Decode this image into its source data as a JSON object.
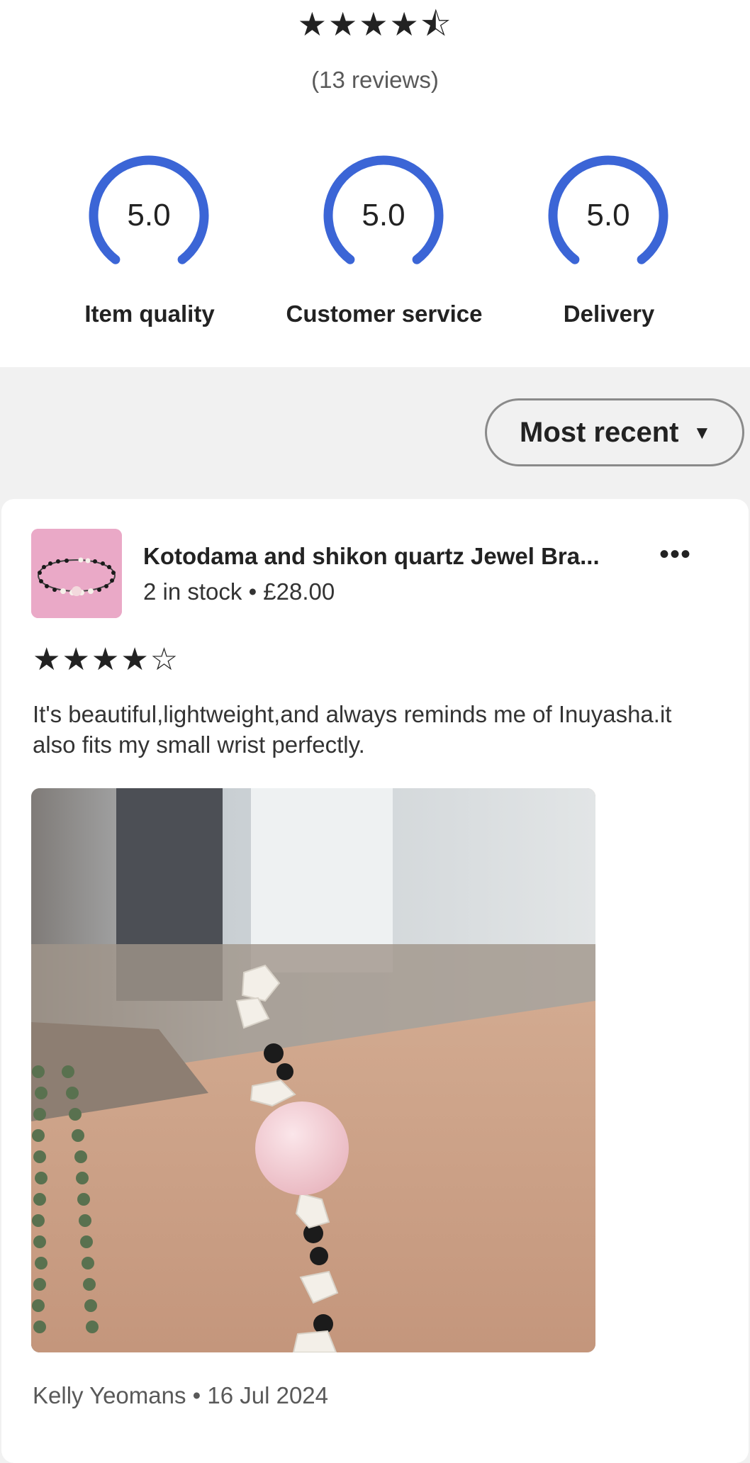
{
  "summary": {
    "stars": "★★★★⯪",
    "review_count": "(13 reviews)",
    "accent_color": "#3b65d6",
    "ratings": [
      {
        "value": "5.0",
        "label": "Item quality"
      },
      {
        "value": "5.0",
        "label": "Customer service"
      },
      {
        "value": "5.0",
        "label": "Delivery"
      }
    ]
  },
  "sort": {
    "label": "Most recent",
    "caret": "▼"
  },
  "review": {
    "product_title": "Kotodama and shikon quartz Jewel Bra...",
    "product_meta": "2 in stock • £28.00",
    "more_icon": "•••",
    "stars": "★★★★☆",
    "rating": 4,
    "text": "It's beautiful,lightweight,and always reminds me of Inuyasha.it also fits my small wrist perfectly.",
    "reviewer_line": "Kelly Yeomans • 16 Jul 2024"
  }
}
